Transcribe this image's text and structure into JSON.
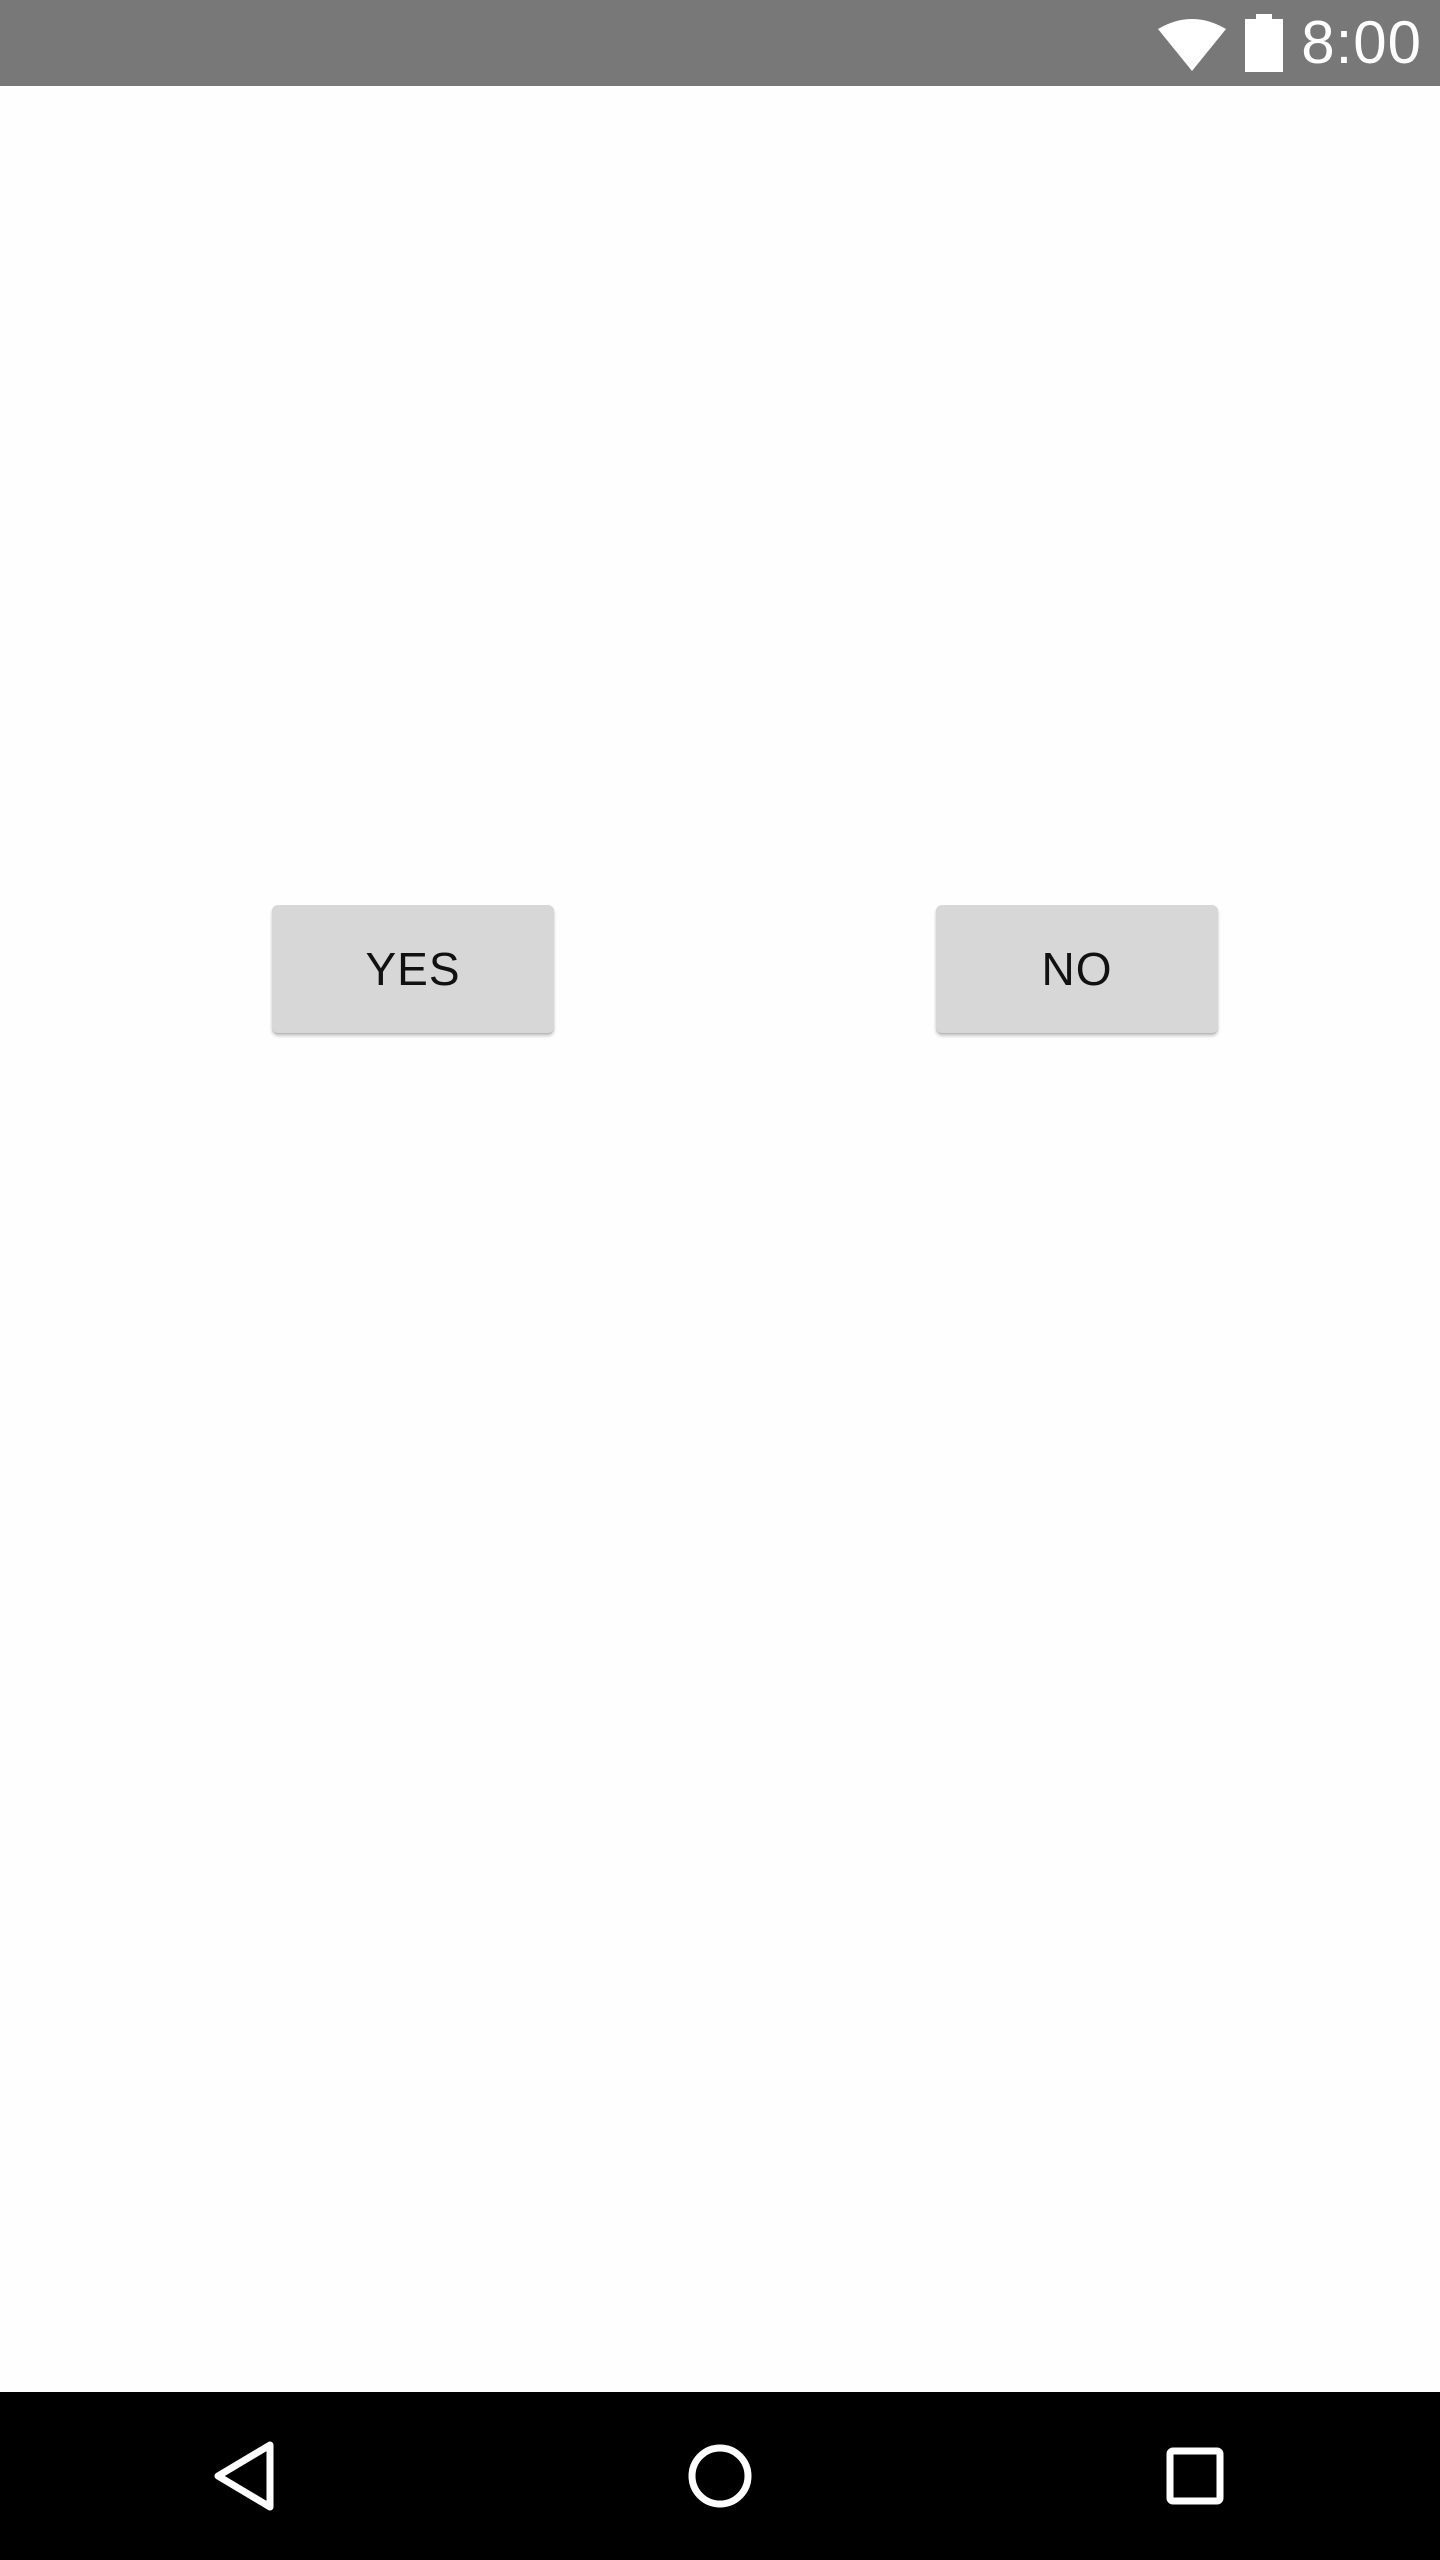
{
  "status_bar": {
    "time": "8:00",
    "icons": [
      "wifi-icon",
      "battery-icon"
    ],
    "background": "#787878"
  },
  "main": {
    "yes_label": "YES",
    "no_label": "NO",
    "button_color": "#d7d7d7"
  },
  "nav_bar": {
    "icons": [
      "back-icon",
      "home-icon",
      "recents-icon"
    ],
    "background": "#000000"
  }
}
